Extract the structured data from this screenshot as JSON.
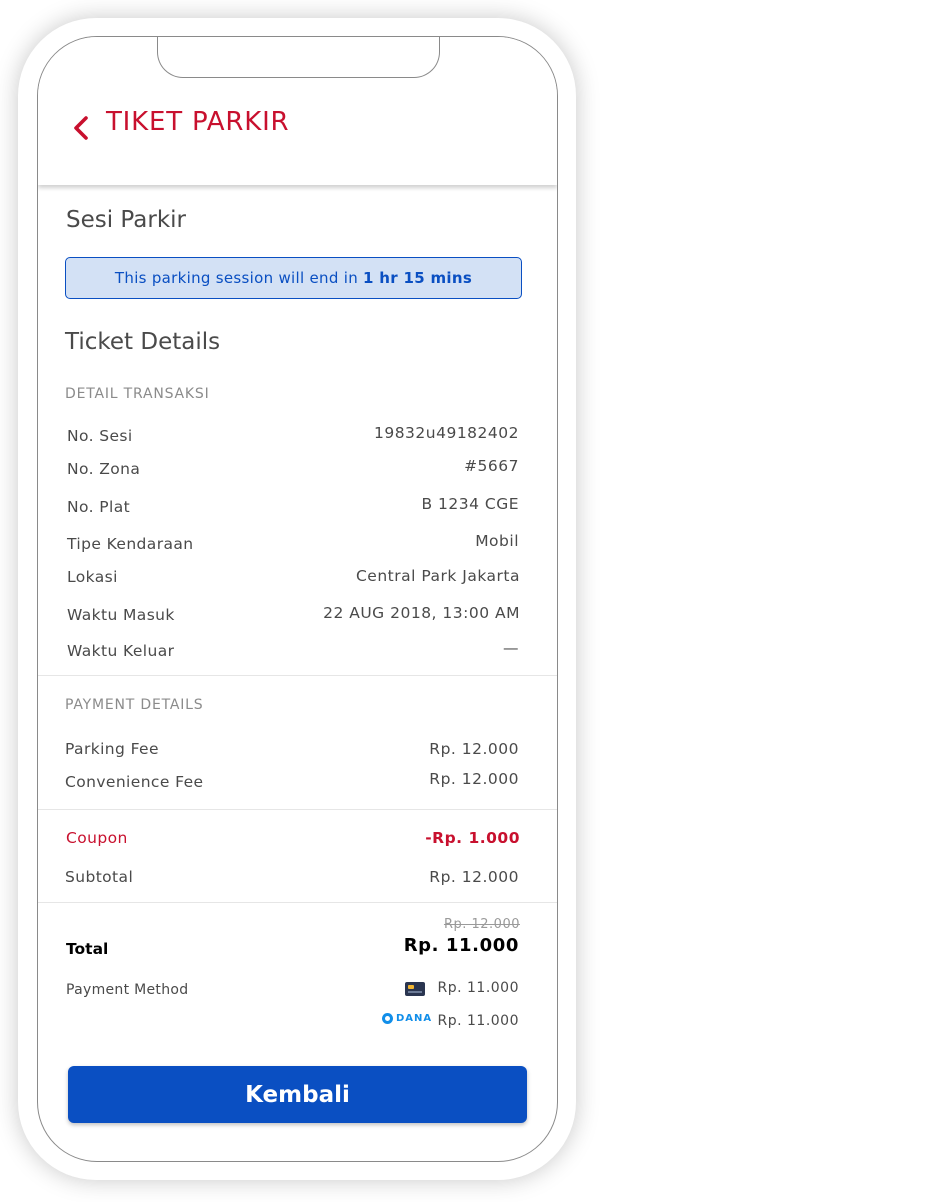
{
  "header": {
    "back_icon": "chevron-left-icon",
    "title": "TIKET PARKIR"
  },
  "session": {
    "title": "Sesi Parkir",
    "banner_text": "This parking session will end in",
    "banner_highlight": "1 hr 15 mins"
  },
  "ticket": {
    "title": "Ticket Details",
    "transaction_label": "DETAIL TRANSAKSI",
    "rows": [
      {
        "label": "No. Sesi",
        "value": "19832u49182402"
      },
      {
        "label": "No. Zona",
        "value": "#5667"
      },
      {
        "label": "No. Plat",
        "value": "B 1234 CGE"
      },
      {
        "label": "Tipe Kendaraan",
        "value": "Mobil"
      },
      {
        "label": "Lokasi",
        "value": "Central Park Jakarta"
      },
      {
        "label": "Waktu Masuk",
        "value": "22 AUG 2018, 13:00 AM"
      },
      {
        "label": "Waktu Keluar",
        "value": "—"
      }
    ]
  },
  "payment": {
    "label": "PAYMENT DETAILS",
    "parking_fee_label": "Parking Fee",
    "parking_fee_value": "Rp. 12.000",
    "convenience_fee_label": "Convenience Fee",
    "convenience_fee_value": "Rp. 12.000",
    "coupon_label": "Coupon",
    "coupon_value": "-Rp. 1.000",
    "subtotal_label": "Subtotal",
    "subtotal_value": "Rp. 12.000",
    "total_original": "Rp. 12.000",
    "total_label": "Total",
    "total_value": "Rp. 11.000",
    "method_label": "Payment Method",
    "methods": [
      {
        "icon": "credit-card-icon",
        "amount": "Rp. 11.000"
      },
      {
        "icon": "dana-logo-icon",
        "brand": "DANA",
        "amount": "Rp. 11.000"
      }
    ]
  },
  "actions": {
    "back_button": "Kembali"
  },
  "colors": {
    "brand_red": "#c8102e",
    "primary_blue": "#0a4fc2",
    "banner_bg": "#d3e1f5"
  }
}
